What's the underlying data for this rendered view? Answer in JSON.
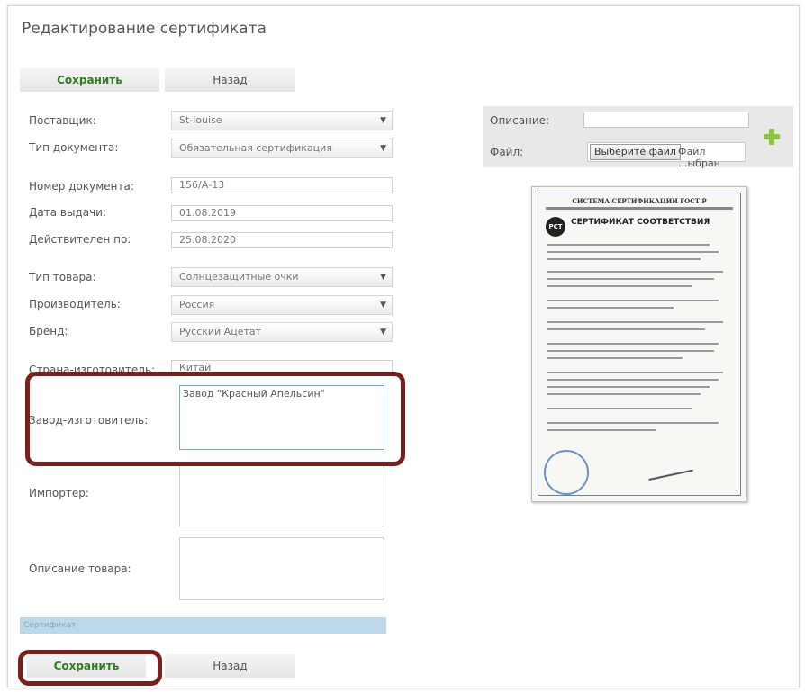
{
  "page_title": "Редактирование сертификата",
  "buttons": {
    "save": "Сохранить",
    "back": "Назад"
  },
  "form": {
    "supplier": {
      "label": "Поставщик:",
      "value": "St-louise"
    },
    "doc_type": {
      "label": "Тип документа:",
      "value": "Обязательная сертификация"
    },
    "doc_number": {
      "label": "Номер документа:",
      "value": "156/А-13"
    },
    "issue_date": {
      "label": "Дата выдачи:",
      "value": "01.08.2019"
    },
    "valid_until": {
      "label": "Действителен по:",
      "value": "25.08.2020"
    },
    "product_type": {
      "label": "Тип товара:",
      "value": "Солнцезащитные очки"
    },
    "manufacturer": {
      "label": "Производитель:",
      "value": "Россия"
    },
    "brand": {
      "label": "Бренд:",
      "value": "Русский Ацетат"
    },
    "country": {
      "label": "Страна-изготовитель:",
      "value": "Китай"
    },
    "factory": {
      "label": "Завод-изготовитель:",
      "value": "Завод \"Красный Апельсин\""
    },
    "importer": {
      "label": "Импортер:",
      "value": ""
    },
    "description": {
      "label": "Описание товара:",
      "value": ""
    }
  },
  "right_panel": {
    "description_label": "Описание:",
    "file_label": "Файл:",
    "choose_file_button": "Выберите файл",
    "file_status": "Файл ...ыбран",
    "add_icon": "plus-icon"
  },
  "certificate_image": {
    "header1": "СИСТЕМА СЕРТИФИКАЦИИ ГОСТ Р",
    "title": "СЕРТИФИКАТ СООТВЕТСТВИЯ",
    "logo": "РСТ"
  },
  "section_bar": "Сертификат",
  "colors": {
    "accent_green": "#2e7d1f",
    "highlight": "#7a1e1e",
    "section_bar": "#bcd8ea",
    "plus": "#8cc63f"
  }
}
